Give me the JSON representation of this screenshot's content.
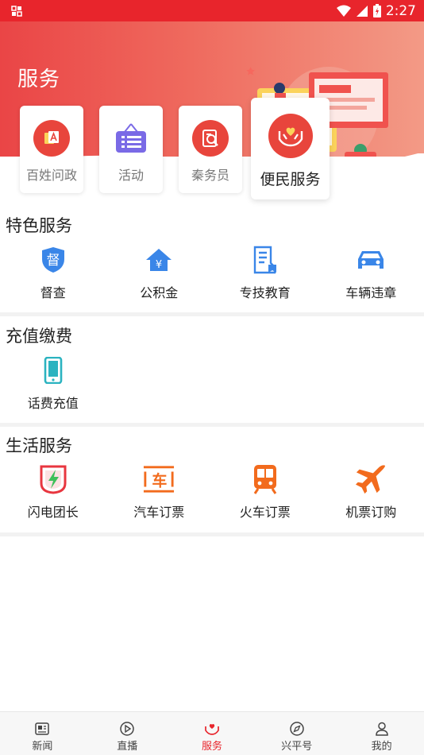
{
  "status_bar": {
    "time": "2:27"
  },
  "hero": {
    "title": "服务"
  },
  "quick_cards": [
    {
      "label": "百姓问政",
      "icon": "question-gov-icon",
      "color": "#e8453c"
    },
    {
      "label": "活动",
      "icon": "activity-board-icon",
      "color": "#6a5acd"
    },
    {
      "label": "秦务员",
      "icon": "search-service-icon",
      "color": "#e8453c"
    },
    {
      "label": "便民服务",
      "icon": "heart-hands-icon",
      "color": "#e8453c"
    }
  ],
  "sections": [
    {
      "title": "特色服务",
      "items": [
        {
          "label": "督查",
          "icon": "supervise-shield-icon"
        },
        {
          "label": "公积金",
          "icon": "housing-fund-icon"
        },
        {
          "label": "专技教育",
          "icon": "education-doc-icon"
        },
        {
          "label": "车辆违章",
          "icon": "car-icon"
        }
      ]
    },
    {
      "title": "充值缴费",
      "items": [
        {
          "label": "话费充值",
          "icon": "phone-icon"
        }
      ]
    },
    {
      "title": "生活服务",
      "items": [
        {
          "label": "闪电团长",
          "icon": "lightning-icon"
        },
        {
          "label": "汽车订票",
          "icon": "bus-ticket-icon"
        },
        {
          "label": "火车订票",
          "icon": "train-icon"
        },
        {
          "label": "机票订购",
          "icon": "plane-icon"
        }
      ]
    }
  ],
  "icon_glyphs": {
    "supervise": "督",
    "fund": "¥",
    "bus": "车"
  },
  "bottom_nav": [
    {
      "label": "新闻",
      "icon": "news-icon",
      "active": false
    },
    {
      "label": "直播",
      "icon": "play-icon",
      "active": false
    },
    {
      "label": "服务",
      "icon": "service-icon",
      "active": true
    },
    {
      "label": "兴平号",
      "icon": "compass-icon",
      "active": false
    },
    {
      "label": "我的",
      "icon": "profile-icon",
      "active": false
    }
  ],
  "colors": {
    "brand_red": "#e8252c",
    "blue": "#3a86e8",
    "teal": "#2bb3c0",
    "orange": "#f26b1d"
  }
}
